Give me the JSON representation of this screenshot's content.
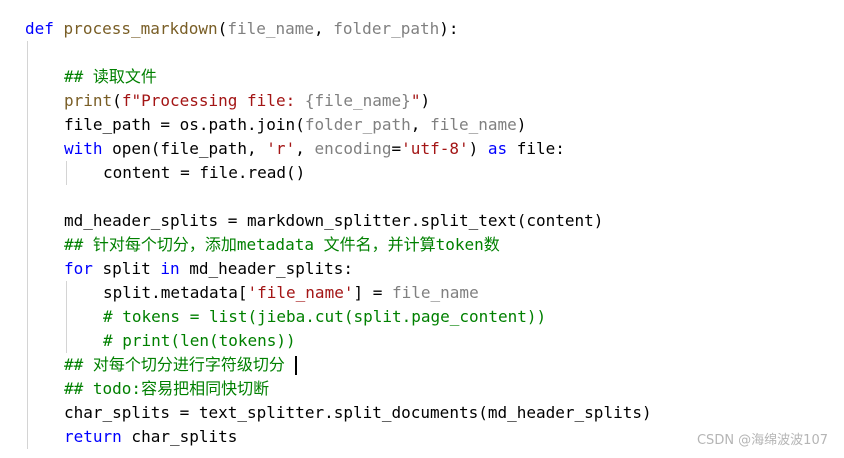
{
  "colors": {
    "keyword": "#0000ff",
    "function": "#795e26",
    "plain": "#000000",
    "param": "#808080",
    "string": "#a31515",
    "comment": "#008000",
    "cursor": "#000000",
    "watermark": "#b5b5b5"
  },
  "code": {
    "lines": [
      {
        "indent": 0,
        "tokens": [
          {
            "t": "def",
            "c": "keyword"
          },
          {
            "t": " ",
            "c": "plain"
          },
          {
            "t": "process_markdown",
            "c": "function"
          },
          {
            "t": "(",
            "c": "plain"
          },
          {
            "t": "file_name",
            "c": "param"
          },
          {
            "t": ", ",
            "c": "plain"
          },
          {
            "t": "folder_path",
            "c": "param"
          },
          {
            "t": "):",
            "c": "plain"
          }
        ]
      },
      {
        "indent": 0,
        "tokens": []
      },
      {
        "indent": 1,
        "tokens": [
          {
            "t": "## 读取文件",
            "c": "comment"
          }
        ]
      },
      {
        "indent": 1,
        "tokens": [
          {
            "t": "print",
            "c": "function"
          },
          {
            "t": "(",
            "c": "plain"
          },
          {
            "t": "f\"Processing file: ",
            "c": "string"
          },
          {
            "t": "{file_name}",
            "c": "param"
          },
          {
            "t": "\"",
            "c": "string"
          },
          {
            "t": ")",
            "c": "plain"
          }
        ]
      },
      {
        "indent": 1,
        "tokens": [
          {
            "t": "file_path = os.path.join(",
            "c": "plain"
          },
          {
            "t": "folder_path",
            "c": "param"
          },
          {
            "t": ", ",
            "c": "plain"
          },
          {
            "t": "file_name",
            "c": "param"
          },
          {
            "t": ")",
            "c": "plain"
          }
        ]
      },
      {
        "indent": 1,
        "tokens": [
          {
            "t": "with",
            "c": "keyword"
          },
          {
            "t": " open(file_path, ",
            "c": "plain"
          },
          {
            "t": "'r'",
            "c": "string"
          },
          {
            "t": ", ",
            "c": "plain"
          },
          {
            "t": "encoding",
            "c": "param"
          },
          {
            "t": "=",
            "c": "plain"
          },
          {
            "t": "'utf-8'",
            "c": "string"
          },
          {
            "t": ") ",
            "c": "plain"
          },
          {
            "t": "as",
            "c": "keyword"
          },
          {
            "t": " file:",
            "c": "plain"
          }
        ]
      },
      {
        "indent": 2,
        "tokens": [
          {
            "t": "content = file.read",
            "c": "plain"
          },
          {
            "t": "()",
            "c": "plain"
          }
        ]
      },
      {
        "indent": 0,
        "tokens": []
      },
      {
        "indent": 1,
        "tokens": [
          {
            "t": "md_header_splits = markdown_splitter.split_text(content)",
            "c": "plain"
          }
        ]
      },
      {
        "indent": 1,
        "tokens": [
          {
            "t": "## 针对每个切分，添加metadata 文件名，并计算token数",
            "c": "comment"
          }
        ]
      },
      {
        "indent": 1,
        "tokens": [
          {
            "t": "for",
            "c": "keyword"
          },
          {
            "t": " split ",
            "c": "plain"
          },
          {
            "t": "in",
            "c": "keyword"
          },
          {
            "t": " md_header_splits:",
            "c": "plain"
          }
        ]
      },
      {
        "indent": 2,
        "tokens": [
          {
            "t": "split.metadata[",
            "c": "plain"
          },
          {
            "t": "'file_name'",
            "c": "string"
          },
          {
            "t": "] = ",
            "c": "plain"
          },
          {
            "t": "file_name",
            "c": "param"
          }
        ]
      },
      {
        "indent": 2,
        "tokens": [
          {
            "t": "# tokens = list(jieba.cut(split.page_content))",
            "c": "comment"
          }
        ]
      },
      {
        "indent": 2,
        "tokens": [
          {
            "t": "# print(len(tokens))",
            "c": "comment"
          }
        ]
      },
      {
        "indent": 1,
        "tokens": [
          {
            "t": "## 对每个切分进行字符级切分 ",
            "c": "comment"
          }
        ],
        "cursor": true
      },
      {
        "indent": 1,
        "tokens": [
          {
            "t": "## todo:容易把相同快切断",
            "c": "comment"
          }
        ]
      },
      {
        "indent": 1,
        "tokens": [
          {
            "t": "char_splits = text_splitter.split_documents(md_header_splits)",
            "c": "plain"
          }
        ]
      },
      {
        "indent": 1,
        "tokens": [
          {
            "t": "return",
            "c": "keyword"
          },
          {
            "t": " char_splits",
            "c": "plain"
          }
        ]
      }
    ]
  },
  "watermark": {
    "text": "CSDN @海绵波波107"
  }
}
